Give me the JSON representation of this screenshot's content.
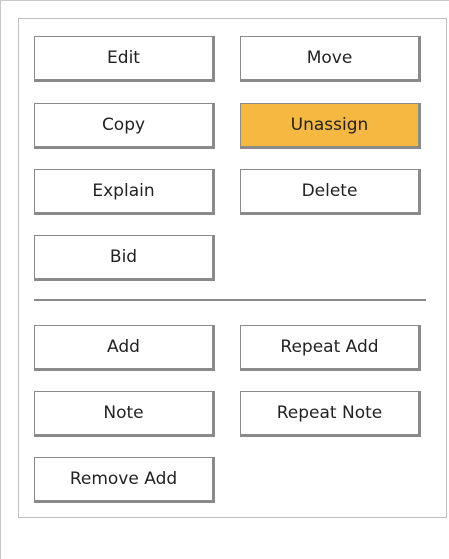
{
  "actions": {
    "edit": "Edit",
    "move": "Move",
    "copy": "Copy",
    "unassign": "Unassign",
    "explain": "Explain",
    "delete": "Delete",
    "bid": "Bid"
  },
  "add_actions": {
    "add": "Add",
    "repeat_add": "Repeat Add",
    "note": "Note",
    "repeat_note": "Repeat Note",
    "remove_add": "Remove Add"
  },
  "colors": {
    "active_button": "#f5b942",
    "border": "#8a8a8a"
  }
}
